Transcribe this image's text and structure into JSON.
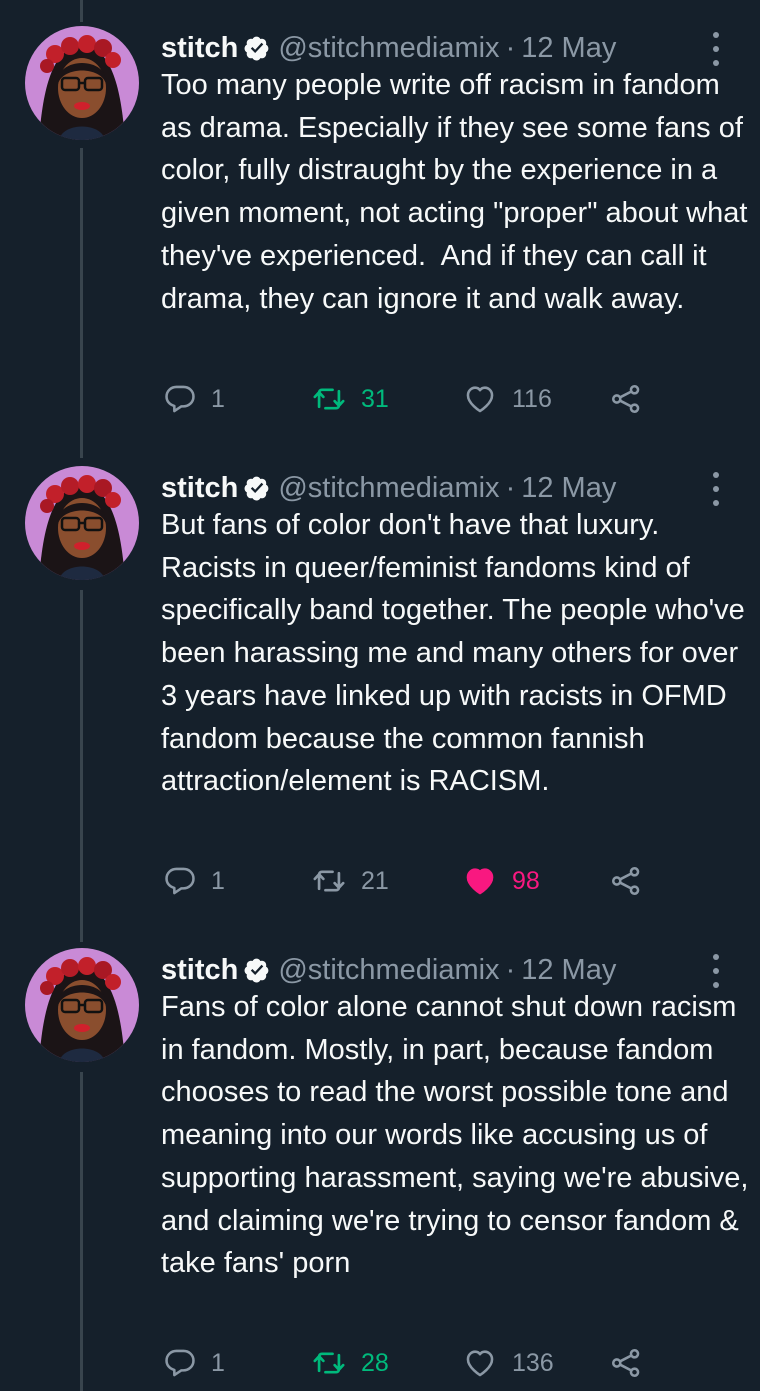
{
  "tweets": [
    {
      "name": "stitch",
      "handle": "@stitchmediamix",
      "separator": "·",
      "date": "12 May",
      "text": "Too many people write off racism in fandom as drama. Especially if they see some fans of color, fully distraught by the experience in a given moment, not acting \"proper\" about what they've experienced.  And if they can call it drama, they can ignore it and walk away.",
      "replies": "1",
      "retweets": "31",
      "retweeted": true,
      "likes": "116",
      "liked": false
    },
    {
      "name": "stitch",
      "handle": "@stitchmediamix",
      "separator": "·",
      "date": "12 May",
      "text": "But fans of color don't have that luxury. Racists in queer/feminist fandoms kind of specifically band together. The people who've been harassing me and many others for over 3 years have linked up with racists in OFMD fandom because the common fannish attraction/element is RACISM.",
      "replies": "1",
      "retweets": "21",
      "retweeted": false,
      "likes": "98",
      "liked": true
    },
    {
      "name": "stitch",
      "handle": "@stitchmediamix",
      "separator": "·",
      "date": "12 May",
      "text": "Fans of color alone cannot shut down racism in fandom. Mostly, in part, because fandom chooses to read the worst possible tone and meaning into our words like accusing us of supporting harassment, saying we're abusive, and claiming we're trying to censor fandom & take fans' porn",
      "replies": "1",
      "retweets": "28",
      "retweeted": true,
      "likes": "136",
      "liked": false
    }
  ],
  "colors": {
    "background": "#15202b",
    "text": "#f7f9f9",
    "muted": "#8b98a5",
    "retweet_active": "#00ba7c",
    "like_active": "#f91880",
    "verified": "#f7f9f9"
  },
  "icons": [
    "verified-badge-icon",
    "more-options-icon",
    "reply-icon",
    "retweet-icon",
    "like-icon",
    "share-icon"
  ]
}
